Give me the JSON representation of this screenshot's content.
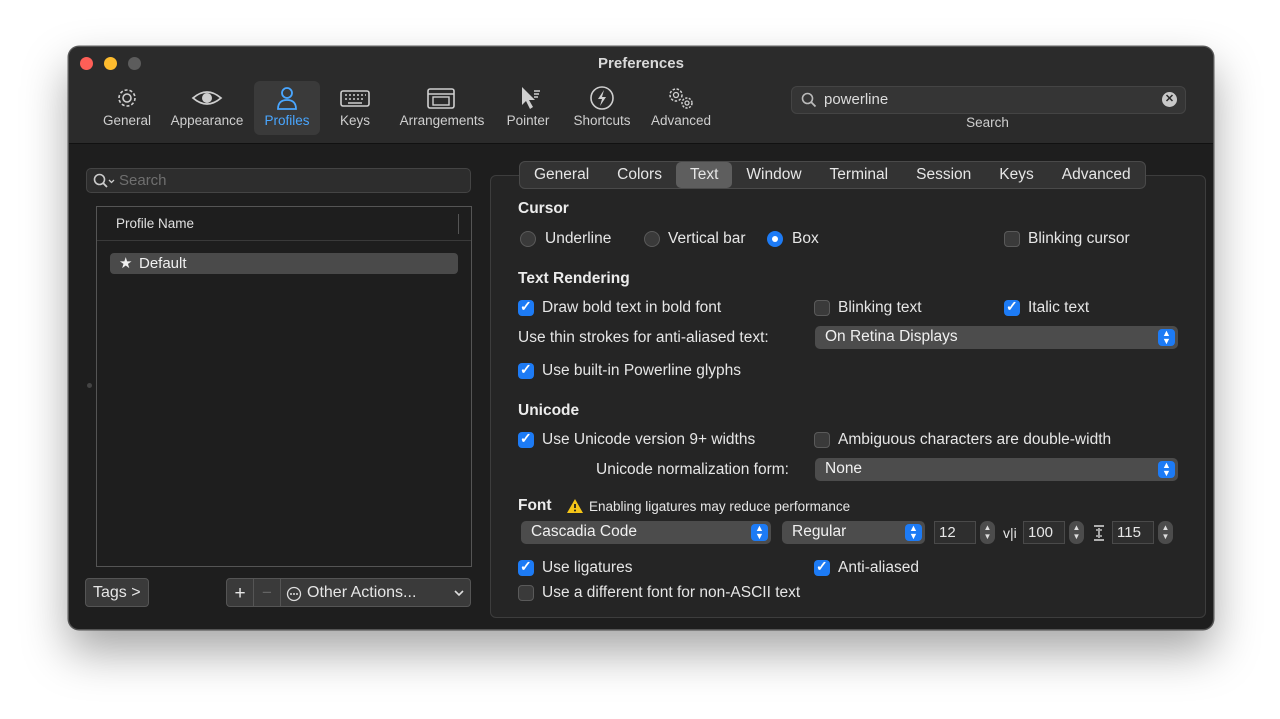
{
  "window": {
    "title": "Preferences"
  },
  "toolbar": {
    "items": [
      {
        "label": "General",
        "icon": "gear-icon"
      },
      {
        "label": "Appearance",
        "icon": "eye-icon"
      },
      {
        "label": "Profiles",
        "icon": "person-icon"
      },
      {
        "label": "Keys",
        "icon": "keyboard-icon"
      },
      {
        "label": "Arrangements",
        "icon": "windows-icon"
      },
      {
        "label": "Pointer",
        "icon": "pointer-icon"
      },
      {
        "label": "Shortcuts",
        "icon": "bolt-icon"
      },
      {
        "label": "Advanced",
        "icon": "gears-icon"
      }
    ],
    "active": "Profiles",
    "search_value": "powerline",
    "search_label": "Search"
  },
  "profiles": {
    "search_placeholder": "Search",
    "column_header": "Profile Name",
    "rows": [
      {
        "name": "Default",
        "default": true
      }
    ],
    "tags_button": "Tags >",
    "add_button": "+",
    "remove_button": "−",
    "other_actions": "Other Actions..."
  },
  "tabs": [
    "General",
    "Colors",
    "Text",
    "Window",
    "Terminal",
    "Session",
    "Keys",
    "Advanced"
  ],
  "active_tab": "Text",
  "cursor": {
    "heading": "Cursor",
    "options": [
      "Underline",
      "Vertical bar",
      "Box"
    ],
    "selected": "Box",
    "blinking_label": "Blinking cursor",
    "blinking": false
  },
  "text_rendering": {
    "heading": "Text Rendering",
    "bold_label": "Draw bold text in bold font",
    "bold": true,
    "blinking_text_label": "Blinking text",
    "blinking_text": false,
    "italic_label": "Italic text",
    "italic": true,
    "thin_strokes_label": "Use thin strokes for anti-aliased text:",
    "thin_strokes_value": "On Retina Displays",
    "powerline_label": "Use built-in Powerline glyphs",
    "powerline": true
  },
  "unicode": {
    "heading": "Unicode",
    "v9_label": "Use Unicode version 9+ widths",
    "v9": true,
    "ambiguous_label": "Ambiguous characters are double-width",
    "ambiguous": false,
    "normalization_label": "Unicode normalization form:",
    "normalization_value": "None"
  },
  "font": {
    "heading": "Font",
    "warning": "Enabling ligatures may reduce performance",
    "family": "Cascadia Code",
    "style": "Regular",
    "size": "12",
    "hspacing_label": "v|i",
    "hspacing": "100",
    "vspacing": "115",
    "ligatures_label": "Use ligatures",
    "ligatures": true,
    "antialiased_label": "Anti-aliased",
    "antialiased": true,
    "nonascii_label": "Use a different font for non-ASCII text",
    "nonascii": false
  },
  "colors": {
    "accent": "#1d7bf5",
    "active_toolbar": "#49a6ff"
  }
}
